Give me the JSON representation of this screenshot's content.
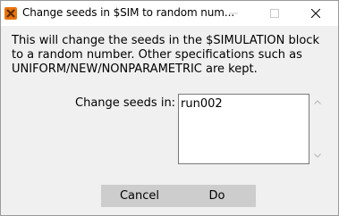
{
  "window": {
    "title": "Change seeds in $SIM to random num..."
  },
  "dialog": {
    "message": "This will change the seeds in the $SIMULATION block to a random number. Other specifications such as UNIFORM/NEW/NONPARAMETRIC are kept.",
    "field_label": "Change seeds in:",
    "field_value": "run002"
  },
  "buttons": {
    "cancel_label": "Cancel",
    "do_label": "Do"
  },
  "colors": {
    "app_icon": "#e8740c",
    "button_bar": "#cdcdcd"
  }
}
